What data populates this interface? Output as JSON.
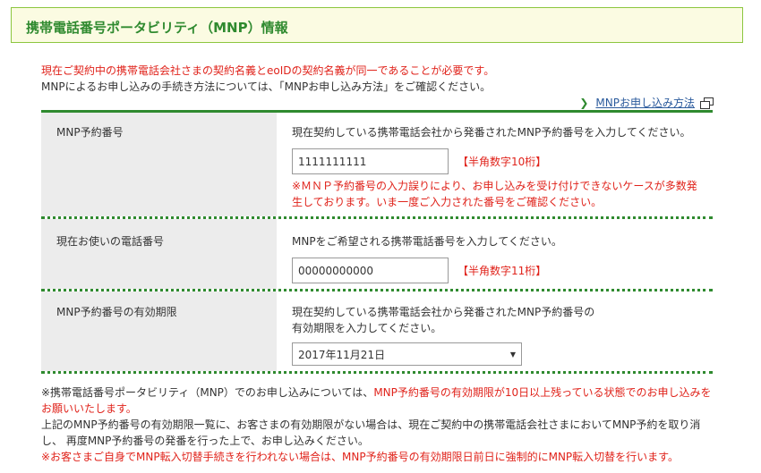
{
  "header": {
    "title": "携帯電話番号ポータビリティ（MNP）情報"
  },
  "intro": {
    "line1": "現在ご契約中の携帯電話会社さまの契約名義とeoIDの契約名義が同一であることが必要です。",
    "line2": "MNPによるお申し込みの手続き方法については、「MNPお申し込み方法」をご確認ください。"
  },
  "mnp_link": {
    "label": "MNPお申し込み方法"
  },
  "form": {
    "mnp_number": {
      "label": "MNP予約番号",
      "description": "現在契約している携帯電話会社から発番されたMNP予約番号を入力してください。",
      "value": "1111111111",
      "hint": "【半角数字10桁】",
      "warning_line1": "※ＭＮＰ予約番号の入力誤りにより、お申し込みを受け付けできないケースが多数発",
      "warning_line2": "生しております。いま一度ご入力された番号をご確認ください。"
    },
    "phone_number": {
      "label": "現在お使いの電話番号",
      "description": "MNPをご希望される携帯電話番号を入力してください。",
      "value": "00000000000",
      "hint": "【半角数字11桁】"
    },
    "expiry": {
      "label": "MNP予約番号の有効期限",
      "description_line1": "現在契約している携帯電話会社から発番されたMNP予約番号の",
      "description_line2": "有効期限を入力してください。",
      "selected": "2017年11月21日"
    }
  },
  "notes": {
    "n1_black": "※携帯電話番号ポータビリティ（MNP）でのお申し込みについては、",
    "n1_red_a": "MNP予約番号の有効期限が10日以上残っている状態でのお申し込みを",
    "n1_red_b": "お願いいたします。",
    "n2_line1": "上記のMNP予約番号の有効期限一覧に、お客さまの有効期限がない場合は、現在ご契約中の携帯電話会社さまにおいてMNP予約を取り消",
    "n2_line2": "し、 再度MNP予約番号の発番を行った上で、お申し込みください。",
    "n3": "※お客さまご自身でMNP転入切替手続きを行われない場合は、MNP予約番号の有効期限日前日に強制的にMNP転入切替を行います。"
  }
}
